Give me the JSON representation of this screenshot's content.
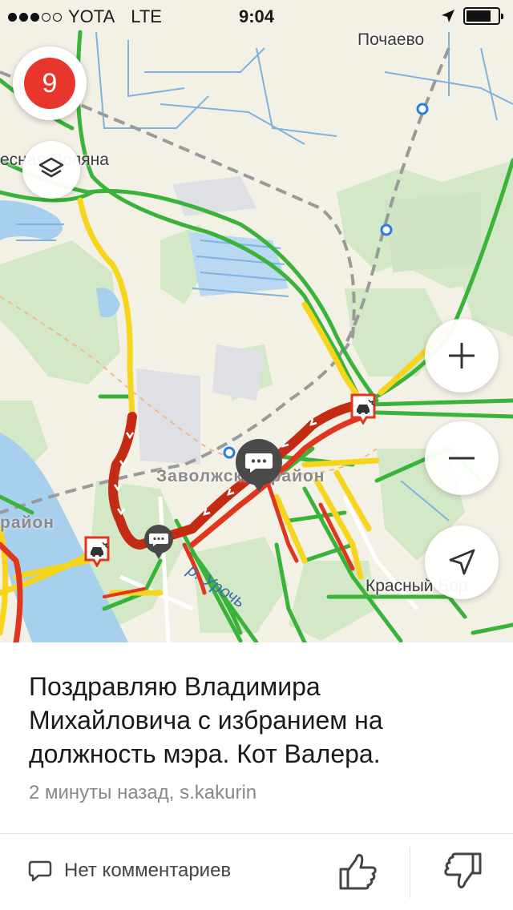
{
  "status_bar": {
    "carrier": "YOTA",
    "network": "LTE",
    "time": "9:04",
    "signal_bars_filled": 3,
    "signal_bars_total": 5,
    "battery_level": 0.8
  },
  "map": {
    "labels": {
      "pochaevo": "Почаево",
      "lesnaya_polyana": "есная Поляна",
      "zavolzhsky": "Заволжский район",
      "rayon_left": "район",
      "krasny_bor": "Красный Бор",
      "river": "р. Урочь"
    },
    "traffic_score": "9",
    "colors": {
      "free_flow": "#3ab33a",
      "slow": "#f7d51d",
      "jam": "#e0351e",
      "heavy_jam": "#c42b14",
      "water": "#a7d0ef",
      "forest": "#d3e8c7",
      "traffic_badge": "#e8362c"
    },
    "icons": [
      "layers-icon",
      "plus-icon",
      "minus-icon",
      "location-arrow-icon",
      "chat-bubble-icon",
      "accident-icon",
      "transit-stop-icon"
    ]
  },
  "post": {
    "message": "Поздравляю Владимира Михайловича с избранием на должность мэра. Кот Валера.",
    "meta": "2 минуты назад, s.kakurin"
  },
  "footer": {
    "comments": "Нет комментариев",
    "icons": [
      "comment-icon",
      "thumbs-up-icon",
      "thumbs-down-icon"
    ]
  }
}
